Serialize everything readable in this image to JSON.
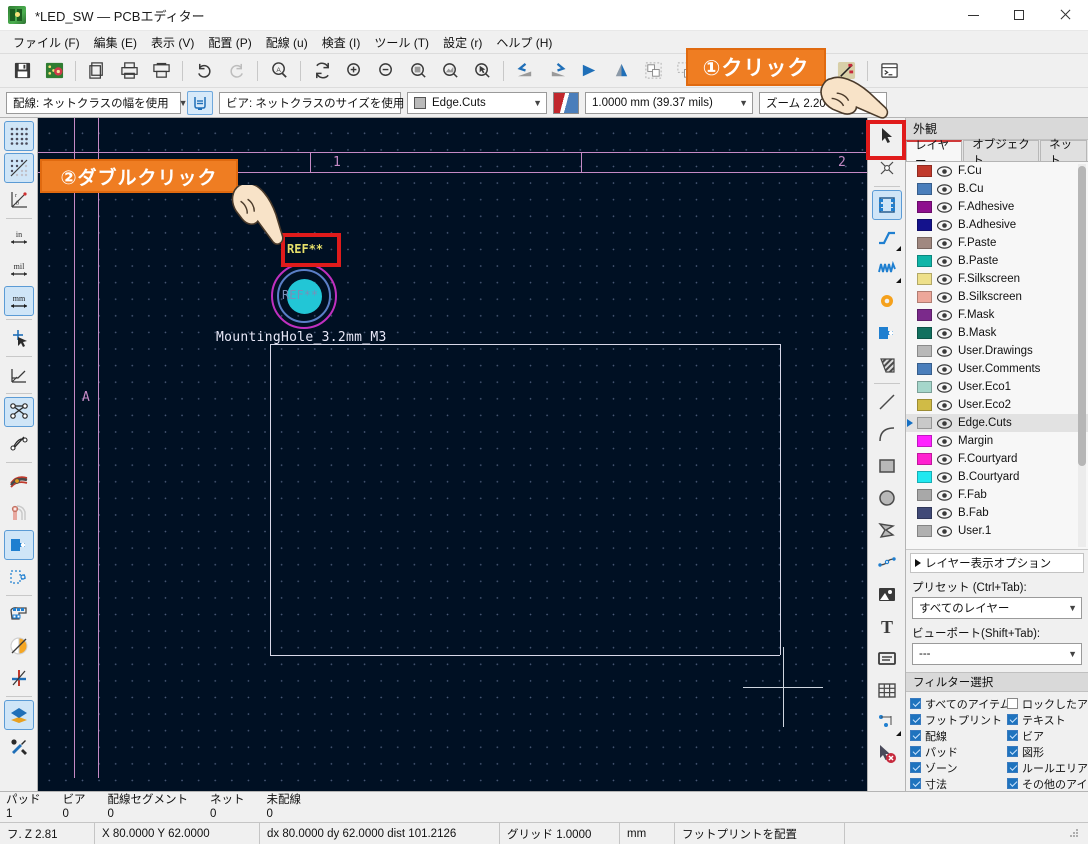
{
  "window": {
    "title": "*LED_SW — PCBエディター",
    "app_icon": "kicad-pcb-icon",
    "minimize": "minimize-icon",
    "maximize": "maximize-icon",
    "close": "close-icon"
  },
  "menu": [
    {
      "label": "ファイル (F)"
    },
    {
      "label": "編集 (E)"
    },
    {
      "label": "表示 (V)"
    },
    {
      "label": "配置 (P)"
    },
    {
      "label": "配線 (u)"
    },
    {
      "label": "検査 (I)"
    },
    {
      "label": "ツール (T)"
    },
    {
      "label": "設定 (r)"
    },
    {
      "label": "ヘルプ (H)"
    }
  ],
  "toolbar_top": [
    {
      "name": "save-icon"
    },
    {
      "name": "board-setup-icon"
    },
    {
      "sep": true
    },
    {
      "name": "page-settings-icon"
    },
    {
      "name": "print-icon"
    },
    {
      "name": "plot-icon"
    },
    {
      "sep": true
    },
    {
      "name": "undo-icon"
    },
    {
      "name": "redo-icon"
    },
    {
      "sep": true
    },
    {
      "name": "find-icon"
    },
    {
      "sep": true
    },
    {
      "name": "refresh-icon"
    },
    {
      "name": "zoom-in-icon"
    },
    {
      "name": "zoom-out-icon"
    },
    {
      "name": "zoom-fit-icon"
    },
    {
      "name": "zoom-objects-icon"
    },
    {
      "name": "zoom-selection-icon"
    },
    {
      "sep": true
    },
    {
      "name": "rotate-ccw-icon"
    },
    {
      "name": "rotate-cw-icon"
    },
    {
      "name": "flip-horizontal-icon"
    },
    {
      "name": "flip-vertical-icon"
    },
    {
      "name": "group-icon"
    },
    {
      "name": "ungroup-icon"
    },
    {
      "sep": true
    },
    {
      "name": "footprint-editor-icon"
    },
    {
      "sep": true
    },
    {
      "name": "3d-viewer-icon"
    },
    {
      "name": "drc-icon"
    },
    {
      "sep": true
    },
    {
      "name": "net-inspector-icon"
    },
    {
      "sep": true
    },
    {
      "name": "scripting-console-icon"
    }
  ],
  "toolbar_select": {
    "track_width": "配線: ネットクラスの幅を使用",
    "track_lock_button": "track-width-lock-icon",
    "via_size": "ビア: ネットクラスのサイズを使用",
    "active_layer": "Edge.Cuts",
    "layer_pair_button": "layer-pair-icon",
    "grid": "1.0000 mm (39.37 mils)",
    "zoom": "ズーム 2.20"
  },
  "left_toolbar": [
    {
      "name": "toggle-grid-icon",
      "active": true
    },
    {
      "name": "grid-overrides-icon",
      "active": true
    },
    {
      "name": "polar-coords-icon",
      "active": false
    },
    {
      "sep": true
    },
    {
      "name": "units-inches-icon",
      "active": false
    },
    {
      "name": "units-mils-icon",
      "active": false
    },
    {
      "name": "units-mm-icon",
      "active": true
    },
    {
      "sep": true
    },
    {
      "name": "full-crosshair-icon",
      "active": false
    },
    {
      "sep": true
    },
    {
      "name": "show-ratsnest-45-icon",
      "active": false
    },
    {
      "sep": true
    },
    {
      "name": "show-ratsnest-icon",
      "active": true
    },
    {
      "name": "curved-ratsnest-icon",
      "active": false
    },
    {
      "sep": true
    },
    {
      "name": "track-fill-icon",
      "active": false
    },
    {
      "name": "via-fill-icon",
      "active": false
    },
    {
      "name": "pad-fill-icon",
      "active": true
    },
    {
      "name": "zone-outline-icon",
      "active": false
    },
    {
      "sep": true
    },
    {
      "name": "footprint-text-icon",
      "active": false
    },
    {
      "name": "zone-fill-icon",
      "active": false
    },
    {
      "name": "no-fill-icon",
      "active": false
    },
    {
      "sep": true
    },
    {
      "name": "contrast-mode-icon",
      "active": true
    },
    {
      "name": "board-tools-icon",
      "active": false
    }
  ],
  "right_toolbar": [
    {
      "name": "select-tool-icon",
      "active": false,
      "highlighted": true
    },
    {
      "name": "local-ratsnest-icon",
      "active": false
    },
    {
      "sep": true
    },
    {
      "name": "place-footprint-icon",
      "active": true
    },
    {
      "name": "route-track-icon",
      "active": false,
      "corner": true
    },
    {
      "name": "route-diff-pair-icon",
      "active": false,
      "corner": true
    },
    {
      "name": "place-via-icon",
      "active": false
    },
    {
      "name": "place-pad-icon",
      "active": false
    },
    {
      "name": "add-zone-icon",
      "active": false
    },
    {
      "sep": true
    },
    {
      "name": "draw-line-icon",
      "active": false
    },
    {
      "name": "draw-arc-icon",
      "active": false
    },
    {
      "name": "draw-rectangle-icon",
      "active": false
    },
    {
      "name": "draw-circle-icon",
      "active": false
    },
    {
      "name": "draw-polygon-icon",
      "active": false
    },
    {
      "name": "draw-bezier-icon",
      "active": false
    },
    {
      "name": "place-image-icon",
      "active": false
    },
    {
      "name": "add-text-icon",
      "active": false
    },
    {
      "name": "add-textbox-icon",
      "active": false
    },
    {
      "name": "add-table-icon",
      "active": false
    },
    {
      "name": "add-dimension-icon",
      "active": false,
      "corner": true
    },
    {
      "name": "delete-tool-icon",
      "active": false
    }
  ],
  "canvas": {
    "background": "#001023",
    "worksheet_marks": [
      "1",
      "2"
    ],
    "row_mark": "A",
    "footprint": {
      "reference": "REF**",
      "reference_value": "REF**",
      "value_label": "MountingHole_3.2mm_M3",
      "pad_color": "#22c6d6",
      "courtyard_color": "#c030c0",
      "fab_color": "#5b7fc7"
    }
  },
  "appearance_panel": {
    "title": "外観",
    "tabs": [
      {
        "label": "レイヤー",
        "active": true
      },
      {
        "label": "オブジェクト",
        "active": false
      },
      {
        "label": "ネット",
        "active": false
      }
    ],
    "layers": [
      {
        "name": "F.Cu",
        "color": "#c0392b",
        "visible": true,
        "selected": false
      },
      {
        "name": "B.Cu",
        "color": "#4a7ebb",
        "visible": true,
        "selected": false
      },
      {
        "name": "F.Adhesive",
        "color": "#8e0f8e",
        "visible": true,
        "selected": false
      },
      {
        "name": "B.Adhesive",
        "color": "#14128c",
        "visible": true,
        "selected": false
      },
      {
        "name": "F.Paste",
        "color": "#a08880",
        "visible": true,
        "selected": false
      },
      {
        "name": "B.Paste",
        "color": "#10b5a8",
        "visible": true,
        "selected": false
      },
      {
        "name": "F.Silkscreen",
        "color": "#eee08a",
        "visible": true,
        "selected": false
      },
      {
        "name": "B.Silkscreen",
        "color": "#eda79a",
        "visible": true,
        "selected": false
      },
      {
        "name": "F.Mask",
        "color": "#7b2a8b",
        "visible": true,
        "selected": false
      },
      {
        "name": "B.Mask",
        "color": "#12705f",
        "visible": true,
        "selected": false
      },
      {
        "name": "User.Drawings",
        "color": "#b8b8b8",
        "visible": true,
        "selected": false
      },
      {
        "name": "User.Comments",
        "color": "#4a7ebb",
        "visible": true,
        "selected": false
      },
      {
        "name": "User.Eco1",
        "color": "#a5d6cb",
        "visible": true,
        "selected": false
      },
      {
        "name": "User.Eco2",
        "color": "#d0bb46",
        "visible": true,
        "selected": false
      },
      {
        "name": "Edge.Cuts",
        "color": "#c9c9c9",
        "visible": true,
        "selected": true
      },
      {
        "name": "Margin",
        "color": "#ff20ff",
        "visible": true,
        "selected": false
      },
      {
        "name": "F.Courtyard",
        "color": "#ff20d0",
        "visible": true,
        "selected": false
      },
      {
        "name": "B.Courtyard",
        "color": "#20e8f0",
        "visible": true,
        "selected": false
      },
      {
        "name": "F.Fab",
        "color": "#a8a8a8",
        "visible": true,
        "selected": false
      },
      {
        "name": "B.Fab",
        "color": "#414a77",
        "visible": true,
        "selected": false
      },
      {
        "name": "User.1",
        "color": "#b0b0b0",
        "visible": true,
        "selected": false
      }
    ],
    "layer_display_options": "レイヤー表示オプション",
    "preset_label": "プリセット (Ctrl+Tab):",
    "preset_value": "すべてのレイヤー",
    "viewport_label": "ビューポート(Shift+Tab):",
    "viewport_value": "---"
  },
  "filter_panel": {
    "title": "フィルター選択",
    "left_column": [
      {
        "label": "すべてのアイテム",
        "checked": true
      },
      {
        "label": "フットプリント",
        "checked": true
      },
      {
        "label": "配線",
        "checked": true
      },
      {
        "label": "パッド",
        "checked": true
      },
      {
        "label": "ゾーン",
        "checked": true
      },
      {
        "label": "寸法",
        "checked": true
      }
    ],
    "right_column": [
      {
        "label": "ロックしたアイテム",
        "checked": false
      },
      {
        "label": "テキスト",
        "checked": true
      },
      {
        "label": "ビア",
        "checked": true
      },
      {
        "label": "図形",
        "checked": true
      },
      {
        "label": "ルールエリア",
        "checked": true
      },
      {
        "label": "その他のアイテム",
        "checked": true
      }
    ]
  },
  "info_bar": [
    {
      "key": "パッド",
      "value": "1"
    },
    {
      "key": "ビア",
      "value": "0"
    },
    {
      "key": "配線セグメント",
      "value": "0"
    },
    {
      "key": "ネット",
      "value": "0"
    },
    {
      "key": "未配線",
      "value": "0"
    }
  ],
  "status_bar": {
    "zoom_cell": "フ. Z 2.81",
    "xy": "X 80.0000  Y 62.0000",
    "delta": "dx 80.0000  dy 62.0000  dist 101.2126",
    "grid": "グリッド 1.0000",
    "units": "mm",
    "message": "フットプリントを配置"
  },
  "annotations": {
    "step1": "①クリック",
    "step2": "②ダブルクリック",
    "highlight_color": "#e01b1b",
    "callout_color": "#ef7d22"
  }
}
